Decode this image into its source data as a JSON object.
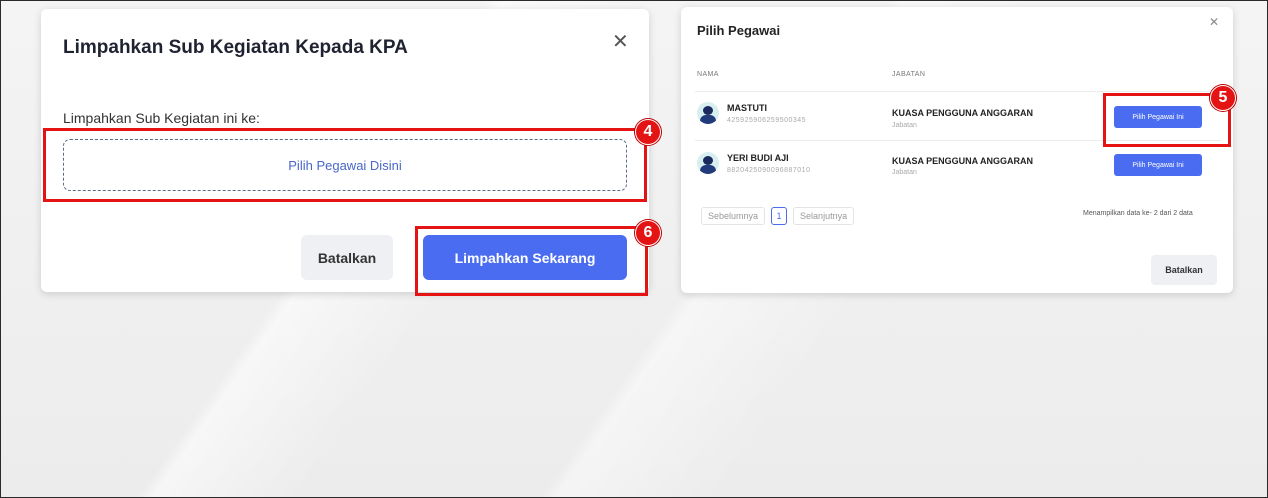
{
  "left_dialog": {
    "title": "Limpahkan Sub Kegiatan Kepada KPA",
    "close_glyph": "✕",
    "field_label": "Limpahkan Sub Kegiatan ini ke:",
    "picker_text": "Pilih Pegawai Disini",
    "cancel_label": "Batalkan",
    "submit_label": "Limpahkan Sekarang"
  },
  "right_dialog": {
    "title": "Pilih Pegawai",
    "close_glyph": "✕",
    "columns": [
      "NAMA",
      "JABATAN"
    ],
    "rows": [
      {
        "name": "MASTUTI",
        "nip": "425925906259500345",
        "jabatan": "KUASA PENGGUNA ANGGARAN",
        "jabatan_sub": "Jabatan",
        "button": "Pilih Pegawai Ini"
      },
      {
        "name": "YERI BUDI AJI",
        "nip": "8820425090096887010",
        "jabatan": "KUASA PENGGUNA ANGGARAN",
        "jabatan_sub": "Jabatan",
        "button": "Pilih Pegawai Ini"
      }
    ],
    "pagination": {
      "prev": "Sebelumnya",
      "current": "1",
      "next": "Selanjutnya"
    },
    "info": "Menampilkan data ke- 2 dari 2 data",
    "cancel_label": "Batalkan"
  },
  "annotations": {
    "step4": "4",
    "step5": "5",
    "step6": "6"
  },
  "colors": {
    "primary": "#4a6cf0",
    "highlight": "#e41414"
  }
}
